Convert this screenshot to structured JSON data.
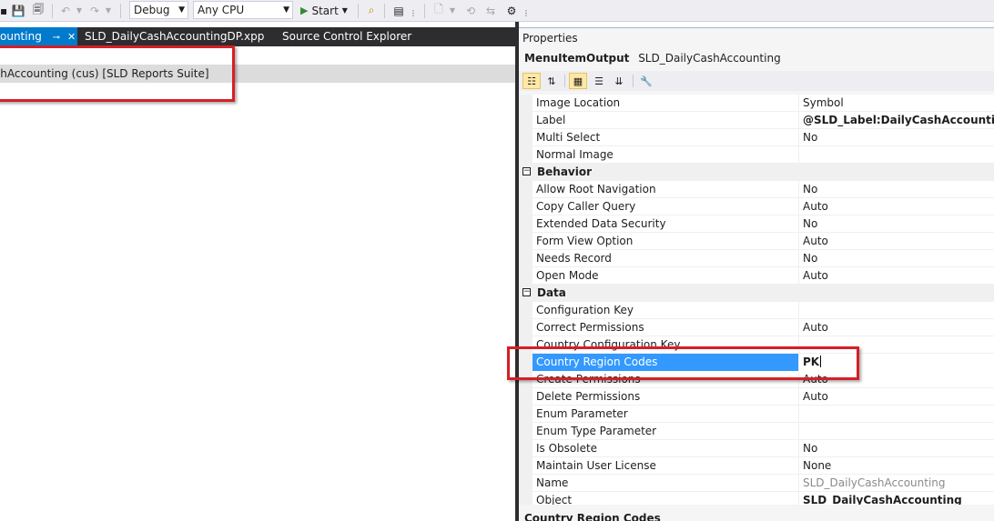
{
  "toolbar": {
    "config_value": "Debug",
    "platform_value": "Any CPU",
    "start_label": "Start"
  },
  "tabs": [
    {
      "label": "ounting"
    },
    {
      "label": "SLD_DailyCashAccountingDP.xpp"
    },
    {
      "label": "Source Control Explorer"
    }
  ],
  "editor": {
    "tree_row": "shAccounting (cus) [SLD Reports Suite]"
  },
  "properties": {
    "title": "Properties",
    "object_type": "MenuItemOutput",
    "object_name": "SLD_DailyCashAccounting",
    "description_title": "Country Region Codes",
    "rows": [
      {
        "kind": "prop",
        "name": "Image Location",
        "value": "Symbol"
      },
      {
        "kind": "prop",
        "name": "Label",
        "value": "@SLD_Label:DailyCashAccounting",
        "bold": true
      },
      {
        "kind": "prop",
        "name": "Multi Select",
        "value": "No"
      },
      {
        "kind": "prop",
        "name": "Normal Image",
        "value": ""
      },
      {
        "kind": "cat",
        "name": "Behavior"
      },
      {
        "kind": "prop",
        "name": "Allow Root Navigation",
        "value": "No"
      },
      {
        "kind": "prop",
        "name": "Copy Caller Query",
        "value": "Auto"
      },
      {
        "kind": "prop",
        "name": "Extended Data Security",
        "value": "No"
      },
      {
        "kind": "prop",
        "name": "Form View Option",
        "value": "Auto"
      },
      {
        "kind": "prop",
        "name": "Needs Record",
        "value": "No"
      },
      {
        "kind": "prop",
        "name": "Open Mode",
        "value": "Auto"
      },
      {
        "kind": "cat",
        "name": "Data"
      },
      {
        "kind": "prop",
        "name": "Configuration Key",
        "value": ""
      },
      {
        "kind": "prop",
        "name": "Correct Permissions",
        "value": "Auto"
      },
      {
        "kind": "prop",
        "name": "Country Configuration Key",
        "value": ""
      },
      {
        "kind": "prop",
        "name": "Country Region Codes",
        "value": "PK",
        "selected": true
      },
      {
        "kind": "prop",
        "name": "Create Permissions",
        "value": "Auto"
      },
      {
        "kind": "prop",
        "name": "Delete Permissions",
        "value": "Auto"
      },
      {
        "kind": "prop",
        "name": "Enum Parameter",
        "value": ""
      },
      {
        "kind": "prop",
        "name": "Enum Type Parameter",
        "value": ""
      },
      {
        "kind": "prop",
        "name": "Is Obsolete",
        "value": "No"
      },
      {
        "kind": "prop",
        "name": "Maintain User License",
        "value": "None"
      },
      {
        "kind": "prop",
        "name": "Name",
        "value": "SLD_DailyCashAccounting",
        "grey": true
      },
      {
        "kind": "prop",
        "name": "Object",
        "value": "SLD_DailyCashAccounting",
        "bold": true
      }
    ]
  },
  "colors": {
    "accent": "#007acc",
    "selection": "#3399ff",
    "annotation_red": "#d61f26"
  }
}
